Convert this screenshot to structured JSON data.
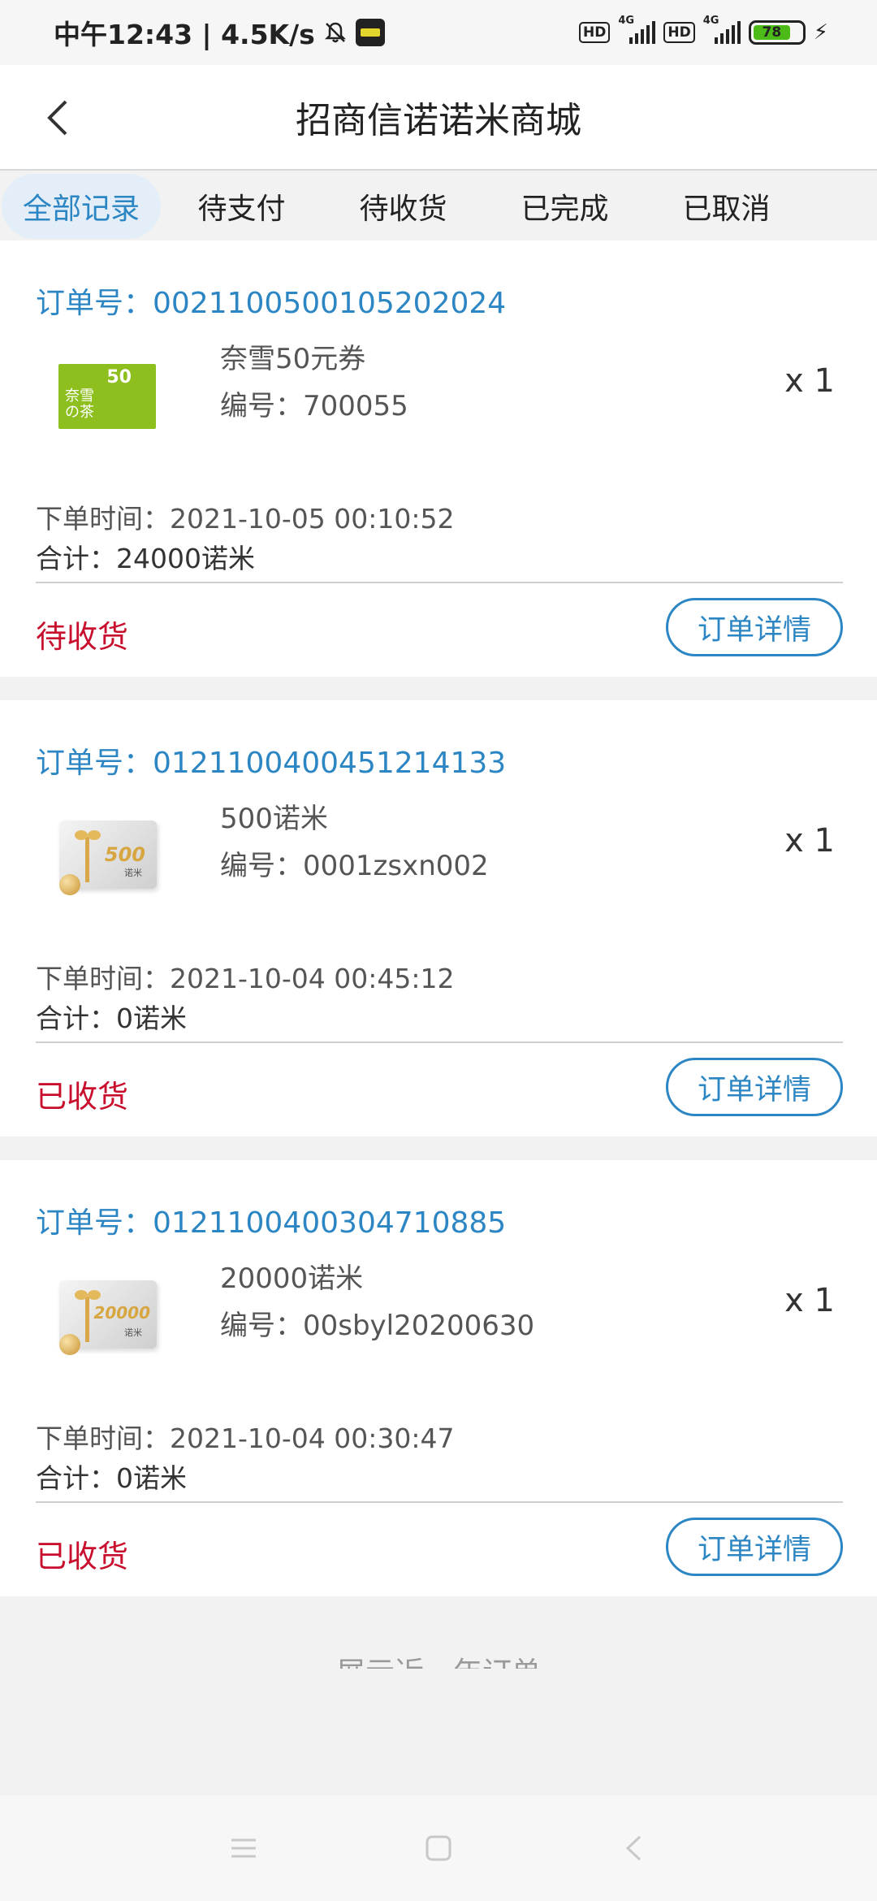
{
  "status_bar": {
    "time_speed": "中午12:43 | 4.5K/s",
    "network_label_1": "4G",
    "network_label_2": "4G",
    "hd_label": "HD",
    "battery": "78"
  },
  "header": {
    "title": "招商信诺诺米商城"
  },
  "tabs": [
    {
      "label": "全部记录",
      "active": true
    },
    {
      "label": "待支付",
      "active": false
    },
    {
      "label": "待收货",
      "active": false
    },
    {
      "label": "已完成",
      "active": false
    },
    {
      "label": "已取消",
      "active": false
    }
  ],
  "orders": [
    {
      "order_no": "订单号：0021100500105202024",
      "product_name": "奈雪50元券",
      "product_code": "编号：700055",
      "quantity": "x 1",
      "order_time": "下单时间：2021-10-05 00:10:52",
      "total": "合计：24000诺米",
      "status": "待收货",
      "detail_label": "订单详情",
      "card": {
        "value": "50",
        "brand_line1": "奈雪",
        "brand_line2": "の茶"
      }
    },
    {
      "order_no": "订单号：0121100400451214133",
      "product_name": "500诺米",
      "product_code": "编号：0001zsxn002",
      "quantity": "x 1",
      "order_time": "下单时间：2021-10-04 00:45:12",
      "total": "合计：0诺米",
      "status": "已收货",
      "detail_label": "订单详情",
      "card": {
        "value": "500",
        "unit": "诺米"
      }
    },
    {
      "order_no": "订单号：0121100400304710885",
      "product_name": "20000诺米",
      "product_code": "编号：00sbyl20200630",
      "quantity": "x 1",
      "order_time": "下单时间：2021-10-04 00:30:47",
      "total": "合计：0诺米",
      "status": "已收货",
      "detail_label": "订单详情",
      "card": {
        "value": "20000",
        "unit": "诺米"
      }
    }
  ],
  "footer": {
    "note": "展示近一年订单"
  },
  "colors": {
    "accent": "#2c86c4",
    "status_red": "#c8102e",
    "nayuki_green": "#8dbf1e"
  }
}
